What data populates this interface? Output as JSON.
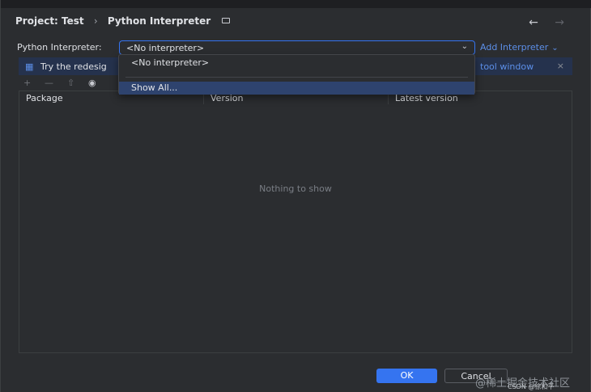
{
  "header": {
    "project_label": "Project: Test",
    "separator": "›",
    "title": "Python Interpreter"
  },
  "nav": {
    "back_symbol": "←",
    "forward_symbol": "→"
  },
  "interpreter": {
    "label": "Python Interpreter:",
    "selected": "<No interpreter>",
    "add_label": "Add Interpreter"
  },
  "banner": {
    "icon": "gift-icon",
    "text": "Try the redesig",
    "link_text": "tool window",
    "close_symbol": "×"
  },
  "toolbar": {
    "add_symbol": "+",
    "remove_symbol": "—",
    "upgrade_symbol": "⇧",
    "show_symbol": "◉"
  },
  "table": {
    "columns": [
      "Package",
      "Version",
      "Latest version"
    ],
    "empty_text": "Nothing to show"
  },
  "dropdown": {
    "items": [
      "<No interpreter>",
      "Show All..."
    ]
  },
  "buttons": {
    "ok": "OK",
    "cancel": "Cancel"
  },
  "watermark": {
    "main": "@稀土掘金技术社区",
    "sub": "CSDN @徐和平"
  },
  "colors": {
    "background": "#2b2d30",
    "accent": "#3574f0",
    "link": "#5c8fe8",
    "selection": "#2e436e",
    "banner": "#25324d"
  }
}
